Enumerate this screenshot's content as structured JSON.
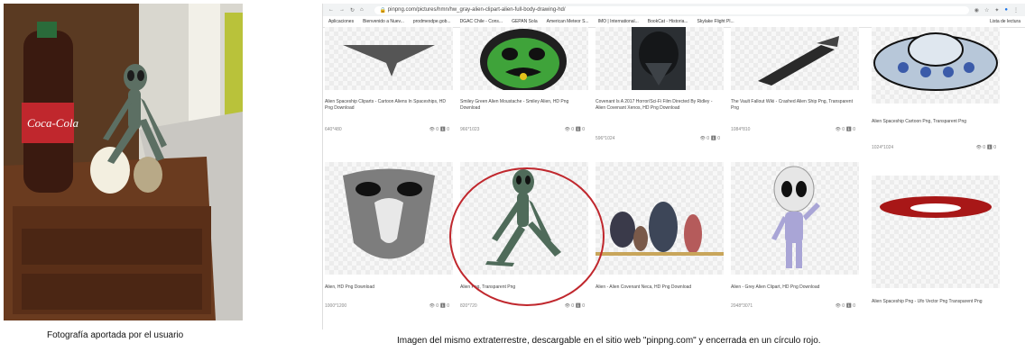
{
  "captions": {
    "left": "Fotografía  aportada  por el usuario",
    "right": "Imagen  del  mismo  extraterrestre,  descargable  en  el  sitio web  \"pinpng.com\"  y encerrada  en  un círculo rojo."
  },
  "browser": {
    "url": "pinpng.com/pictures/hmn/hw_gray-alien-clipart-alien-full-body-drawing-hd/",
    "bookmarks": [
      "Aplicaciones",
      "Bienvenido a Nuev...",
      "prodmexdpe.gob...",
      "DGAC Chile - Cons...",
      "GEPAN Sola",
      "American Meteor S...",
      "IMO | International...",
      "BookCat - Historia...",
      "Skylake Flight Pl...",
      "Lista de lectura"
    ],
    "accent": "#1a73e8"
  },
  "results": [
    {
      "title": "Alien Spaceship Cliparts - Cartoon Aliens In Spaceships, HD Png Download",
      "size": "640*480",
      "stats": "👁 0  ⬇ 0"
    },
    {
      "title": "Smiley Green Alien Moustache - Smiley Alien, HD Png Download",
      "size": "966*1023",
      "stats": "👁 0  ⬇ 0"
    },
    {
      "title": "Covenant Is A 2017 Horror/Sci-Fi Film Directed By Ridley - Alien Covenant Xenos, HD Png Download",
      "size": "596*1024",
      "stats": "👁 0  ⬇ 0"
    },
    {
      "title": "The Vault Fallout Wiki - Crashed Alien Ship Png, Transparent Png",
      "size": "1084*810",
      "stats": "👁 0  ⬇ 0"
    },
    {
      "title": "Alien Spaceship Cartoon Png, Transparent Png",
      "size": "1024*1024",
      "stats": "👁 0  ⬇ 0"
    },
    {
      "title": "Alien, HD Png Download",
      "size": "1000*1200",
      "stats": "👁 0  ⬇ 0"
    },
    {
      "title": "Alien Png, Transparent Png",
      "size": "820*720",
      "stats": "👁 0  ⬇ 0"
    },
    {
      "title": "Alien - Alien Covenant Neca, HD Png Download",
      "size": "",
      "stats": ""
    },
    {
      "title": "Alien - Grey Alien Clipart, HD Png Download",
      "size": "2048*3071",
      "stats": "👁 0  ⬇ 0"
    },
    {
      "title": "Alien Spaceship Png - Ufo Vector Png Transparent Png",
      "size": "",
      "stats": ""
    }
  ],
  "highlight_color": "#c0272d"
}
